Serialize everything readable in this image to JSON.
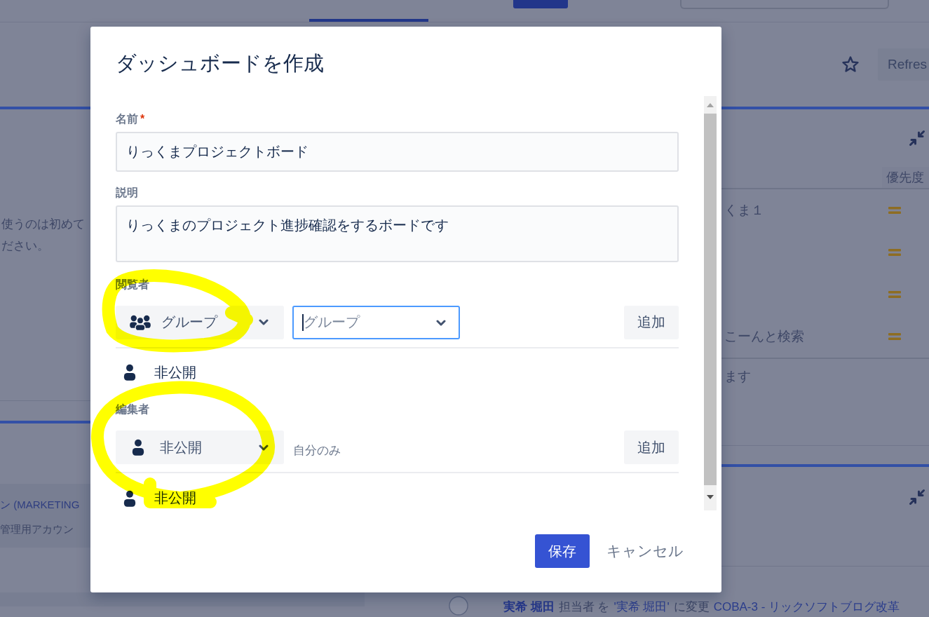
{
  "background": {
    "header": {
      "refresh_button": "Refres"
    },
    "left_gadgets": [
      {
        "kind": "text",
        "lines": [
          "使うのは初めて",
          "ださい。"
        ]
      },
      {
        "kind": "card",
        "lines": [
          "ン (MARKETING",
          "管理用アカウン"
        ]
      }
    ],
    "issues_gadget": {
      "priority_header": "優先度",
      "rows": [
        {
          "summary": "くま１"
        },
        {},
        {},
        {
          "summary": "こーんと検索"
        }
      ],
      "footer_text": "ます"
    },
    "activity": {
      "user": "実希 堀田",
      "action": "担当者 を",
      "value": "'実希 堀田'",
      "change": "に変更",
      "issue": "COBA-3 - リックソフトブログ改革"
    }
  },
  "dialog": {
    "title": "ダッシュボードを作成",
    "fields": [
      {
        "label": "名前",
        "required_mark": "*",
        "kind": "input",
        "value": "りっくまプロジェクトボード"
      },
      {
        "label": "説明",
        "kind": "textarea",
        "value": "りっくまのプロジェクト進捗確認をするボードです"
      }
    ],
    "sharing": [
      {
        "label": "閲覧者",
        "kind": "group",
        "share_type": "グループ",
        "picker": {
          "placeholder": "グループ",
          "focused": true
        },
        "add_button": "追加",
        "entries": [
          "非公開"
        ]
      },
      {
        "label": "編集者",
        "kind": "private",
        "share_type": "非公開",
        "note": "自分のみ",
        "add_button": "追加",
        "entries": [
          "非公開"
        ]
      }
    ],
    "buttons": [
      {
        "label": "保存",
        "kind": "primary"
      },
      {
        "label": "キャンセル",
        "kind": "link"
      }
    ]
  }
}
